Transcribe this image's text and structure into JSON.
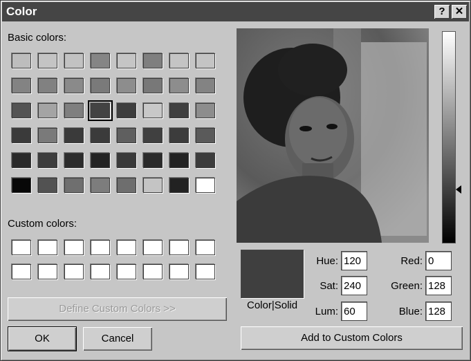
{
  "window": {
    "title": "Color",
    "help_label": "?",
    "close_label": "✕"
  },
  "labels": {
    "basic_colors": "Basic colors:",
    "custom_colors": "Custom colors:",
    "color_solid": "Color|Solid"
  },
  "basic_colors": [
    [
      "#bdbdbd",
      "#c4c4c4",
      "#c2c2c2",
      "#858585",
      "#c5c5c5",
      "#7f7f7f",
      "#c4c4c4",
      "#c4c4c4"
    ],
    [
      "#838383",
      "#818181",
      "#8a8a8a",
      "#7a7a7a",
      "#8d8d8d",
      "#787878",
      "#8d8d8d",
      "#838383"
    ],
    [
      "#535353",
      "#a4a4a4",
      "#7f7f7f",
      "#434343",
      "#3e3e3e",
      "#c8c8c8",
      "#404040",
      "#8d8d8d"
    ],
    [
      "#3a3a3a",
      "#7a7a7a",
      "#3a3a3a",
      "#3b3b3b",
      "#5f5f5f",
      "#404040",
      "#3c3c3c",
      "#5a5a5a"
    ],
    [
      "#2a2a2a",
      "#3d3d3d",
      "#2c2c2c",
      "#232323",
      "#3a3a3a",
      "#2a2a2a",
      "#232323",
      "#3c3c3c"
    ],
    [
      "#080808",
      "#525252",
      "#6f6f6f",
      "#7d7d7d",
      "#6e6e6e",
      "#c4c4c4",
      "#222222",
      "#ffffff"
    ]
  ],
  "selected_basic": {
    "row": 2,
    "col": 3
  },
  "custom_colors": [
    [
      "#ffffff",
      "#ffffff",
      "#ffffff",
      "#ffffff",
      "#ffffff",
      "#ffffff",
      "#ffffff",
      "#ffffff"
    ],
    [
      "#ffffff",
      "#ffffff",
      "#ffffff",
      "#ffffff",
      "#ffffff",
      "#ffffff",
      "#ffffff",
      "#ffffff"
    ]
  ],
  "preview_color": "#3f3f3f",
  "fields": {
    "hue": {
      "label": "Hue:",
      "value": "120"
    },
    "sat": {
      "label": "Sat:",
      "value": "240"
    },
    "lum": {
      "label": "Lum:",
      "value": "60"
    },
    "red": {
      "label": "Red:",
      "value": "0"
    },
    "green": {
      "label": "Green:",
      "value": "128"
    },
    "blue": {
      "label": "Blue:",
      "value": "128"
    }
  },
  "buttons": {
    "define_custom": "Define Custom Colors >>",
    "ok": "OK",
    "cancel": "Cancel",
    "add_custom": "Add to Custom Colors"
  },
  "luminance_level": 0.25
}
